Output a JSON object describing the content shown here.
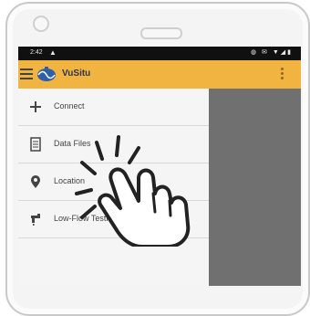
{
  "status_bar": {
    "time": "2:42",
    "warning_glyph": "▲",
    "right_icons": "◍ ✉ ▼◢▮"
  },
  "app_bar": {
    "title": "VuSitu",
    "menu_icon": "hamburger-icon",
    "logo_icon": "vusitu-logo-icon",
    "overflow_icon": "more-vert-icon"
  },
  "drawer": {
    "items": [
      {
        "label": "Connect",
        "icon": "move-icon"
      },
      {
        "label": "Data Files",
        "icon": "document-icon"
      },
      {
        "label": "Location",
        "icon": "location-pin-icon"
      },
      {
        "label": "Low-Flow Testing",
        "icon": "faucet-icon"
      }
    ]
  },
  "overlay": {
    "gesture": "tap-hand-icon"
  },
  "colors": {
    "app_bar": "#f2b441",
    "status_bar": "#101010",
    "drawer": "#f5f5f5",
    "scrim": "#707070"
  }
}
